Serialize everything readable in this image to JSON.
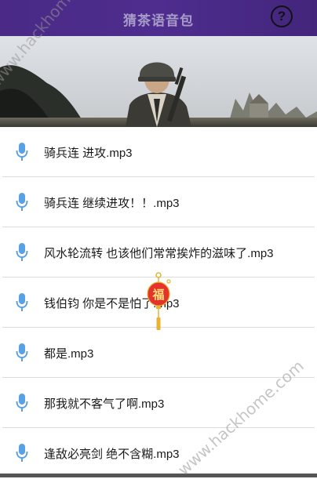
{
  "header": {
    "title": "猜茶语音包",
    "help_label": "?"
  },
  "list": {
    "items": [
      {
        "label": "骑兵连 进攻.mp3"
      },
      {
        "label": "骑兵连 继续进攻！！.mp3"
      },
      {
        "label": "风水轮流转 也该他们常常挨炸的滋味了.mp3"
      },
      {
        "label": "钱伯钧 你是不是怕了.mp3"
      },
      {
        "label": "都是.mp3"
      },
      {
        "label": "那我就不客气了啊.mp3"
      },
      {
        "label": "逢敌必亮剑 绝不含糊.mp3"
      }
    ]
  },
  "watermark": {
    "text": "www.hackhome.com"
  },
  "lantern": {
    "text": "福"
  },
  "colors": {
    "header_bg": "#4a2a86",
    "mic_icon": "#5aa0e6",
    "lantern_red": "#e5322d",
    "lantern_gold": "#e8b330"
  }
}
